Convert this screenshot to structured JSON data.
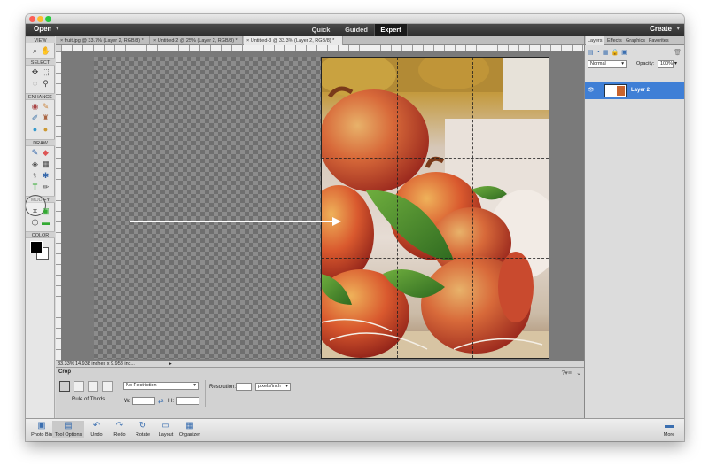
{
  "menubar": {
    "open_label": "Open",
    "modes": [
      "Quick",
      "Guided",
      "Expert"
    ],
    "active_mode": "Expert",
    "create_label": "Create"
  },
  "toolbar": {
    "sections": [
      "VIEW",
      "SELECT",
      "ENHANCE",
      "DRAW",
      "MODIFY",
      "COLOR"
    ]
  },
  "document_tabs": [
    "fruit.jpg @ 33.7% (Layer 2, RGB/8) *",
    "Untitled-2 @ 25% (Layer 2, RGB/8) *",
    "Untitled-3 @ 33.3% (Layer 2, RGB/8) *"
  ],
  "status": {
    "zoom": "33.33%",
    "doc_size": "14.938 inches x 9.958 inc..."
  },
  "tool_options": {
    "tool_name": "Crop",
    "grid_overlay_label": "Rule of Thirds",
    "preset_value": "No Restriction",
    "width_label": "W:",
    "height_label": "H:",
    "width_value": "",
    "height_value": "",
    "resolution_label": "Resolution:",
    "resolution_value": "",
    "resolution_unit": "pixels/inch"
  },
  "panel": {
    "tabs": [
      "Layers",
      "Effects",
      "Graphics",
      "Favorites"
    ],
    "active_tab": "Layers",
    "blend_mode": "Normal",
    "opacity_label": "Opacity:",
    "opacity_value": "100%",
    "layers": [
      {
        "name": "Layer 2",
        "selected": true
      }
    ]
  },
  "bottom_bar": {
    "items": [
      "Photo Bin",
      "Tool Options",
      "Undo",
      "Redo",
      "Rotate",
      "Layout",
      "Organizer"
    ],
    "more_label": "More"
  },
  "colors": {
    "accent_blue": "#3f7fd6",
    "mode_bar": "#2e2e2e",
    "canvas_bg": "#7a7a7a"
  }
}
